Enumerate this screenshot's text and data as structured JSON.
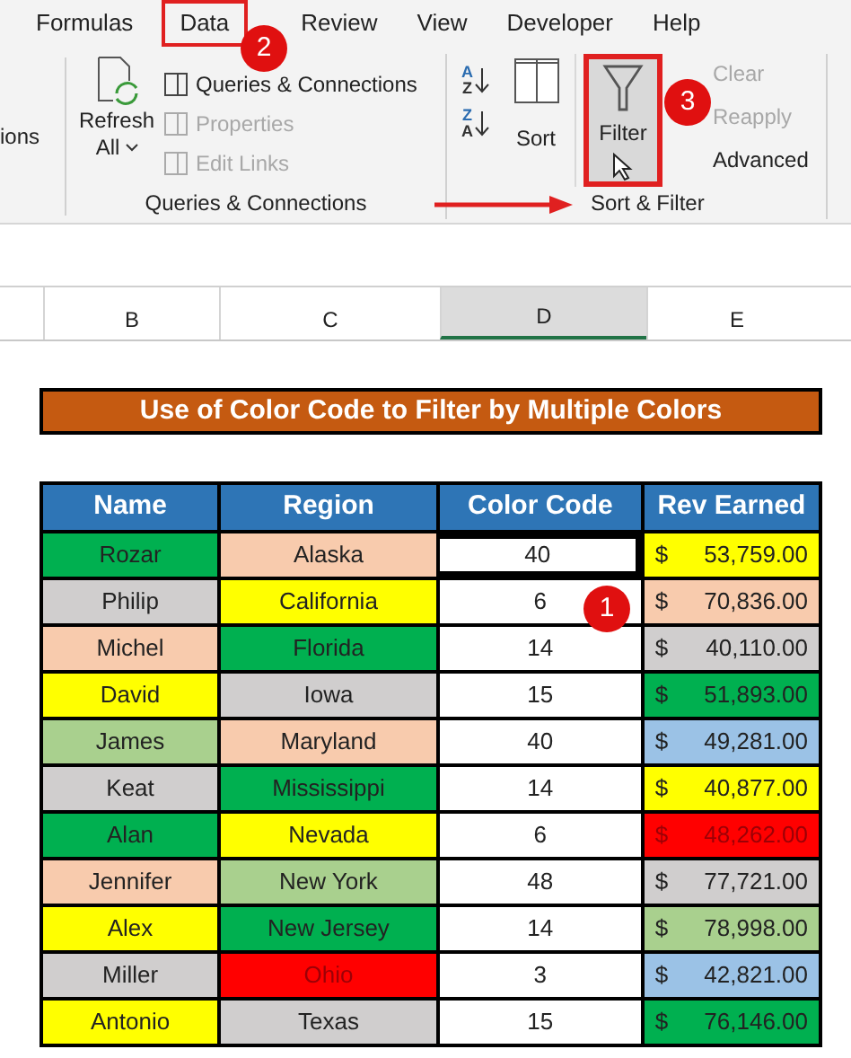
{
  "ribbon": {
    "tabs": [
      {
        "label": "Formulas",
        "selected": false
      },
      {
        "label": "Data",
        "selected": true
      },
      {
        "label": "Review",
        "selected": false
      },
      {
        "label": "View",
        "selected": false
      },
      {
        "label": "Developer",
        "selected": false
      },
      {
        "label": "Help",
        "selected": false
      }
    ],
    "cut_label": "ions",
    "queries_group": {
      "label": "Queries & Connections",
      "refresh": [
        "Refresh",
        "All"
      ],
      "items": [
        {
          "label": "Queries & Connections",
          "disabled": false
        },
        {
          "label": "Properties",
          "disabled": true
        },
        {
          "label": "Edit Links",
          "disabled": true
        }
      ]
    },
    "sort_filter_group": {
      "label": "Sort & Filter",
      "sort_letters": [
        "A",
        "Z",
        "Z",
        "A"
      ],
      "sort": "Sort",
      "filter": {
        "label": "Filter",
        "pressed": true
      },
      "items": [
        {
          "label": "Clear",
          "disabled": true
        },
        {
          "label": "Reapply",
          "disabled": true
        },
        {
          "label": "Advanced",
          "disabled": false
        }
      ]
    }
  },
  "column_headers": [
    {
      "label": "B",
      "selected": false
    },
    {
      "label": "C",
      "selected": false
    },
    {
      "label": "D",
      "selected": true
    },
    {
      "label": "E",
      "selected": false
    }
  ],
  "title": "Use of Color Code to Filter by Multiple Colors",
  "table": {
    "columns": [
      "Name",
      "Region",
      "Color Code",
      "Rev Earned"
    ],
    "rows": [
      {
        "name": {
          "text": "Rozar",
          "color": "#00b050"
        },
        "region": {
          "text": "Alaska",
          "color": "#f8cbad"
        },
        "code": "40",
        "rev": {
          "currency": "$",
          "amount": "53,759.00",
          "color": "#ffff00"
        }
      },
      {
        "name": {
          "text": "Philip",
          "color": "#d0cece"
        },
        "region": {
          "text": "California",
          "color": "#ffff00"
        },
        "code": "6",
        "rev": {
          "currency": "$",
          "amount": "70,836.00",
          "color": "#f8cbad"
        }
      },
      {
        "name": {
          "text": "Michel",
          "color": "#f8cbad"
        },
        "region": {
          "text": "Florida",
          "color": "#00b050"
        },
        "code": "14",
        "rev": {
          "currency": "$",
          "amount": "40,110.00",
          "color": "#d0cece"
        }
      },
      {
        "name": {
          "text": "David",
          "color": "#ffff00"
        },
        "region": {
          "text": "Iowa",
          "color": "#d0cece"
        },
        "code": "15",
        "rev": {
          "currency": "$",
          "amount": "51,893.00",
          "color": "#00b050"
        }
      },
      {
        "name": {
          "text": "James",
          "color": "#a9d08e"
        },
        "region": {
          "text": "Maryland",
          "color": "#f8cbad"
        },
        "code": "40",
        "rev": {
          "currency": "$",
          "amount": "49,281.00",
          "color": "#9bc2e6"
        }
      },
      {
        "name": {
          "text": "Keat",
          "color": "#d0cece"
        },
        "region": {
          "text": "Mississippi",
          "color": "#00b050"
        },
        "code": "14",
        "rev": {
          "currency": "$",
          "amount": "40,877.00",
          "color": "#ffff00"
        }
      },
      {
        "name": {
          "text": "Alan",
          "color": "#00b050"
        },
        "region": {
          "text": "Nevada",
          "color": "#ffff00"
        },
        "code": "6",
        "rev": {
          "currency": "$",
          "amount": "48,262.00",
          "color": "#ff0000"
        }
      },
      {
        "name": {
          "text": "Jennifer",
          "color": "#f8cbad"
        },
        "region": {
          "text": "New York",
          "color": "#a9d08e"
        },
        "code": "48",
        "rev": {
          "currency": "$",
          "amount": "77,721.00",
          "color": "#d0cece"
        }
      },
      {
        "name": {
          "text": "Alex",
          "color": "#ffff00"
        },
        "region": {
          "text": "New Jersey",
          "color": "#00b050"
        },
        "code": "14",
        "rev": {
          "currency": "$",
          "amount": "78,998.00",
          "color": "#a9d08e"
        }
      },
      {
        "name": {
          "text": "Miller",
          "color": "#d0cece"
        },
        "region": {
          "text": "Ohio",
          "color": "#ff0000"
        },
        "code": "3",
        "rev": {
          "currency": "$",
          "amount": "42,821.00",
          "color": "#9bc2e6"
        }
      },
      {
        "name": {
          "text": "Antonio",
          "color": "#ffff00"
        },
        "region": {
          "text": "Texas",
          "color": "#d0cece"
        },
        "code": "15",
        "rev": {
          "currency": "$",
          "amount": "76,146.00",
          "color": "#00b050"
        }
      }
    ]
  },
  "step_badges": [
    "1",
    "2",
    "3"
  ]
}
